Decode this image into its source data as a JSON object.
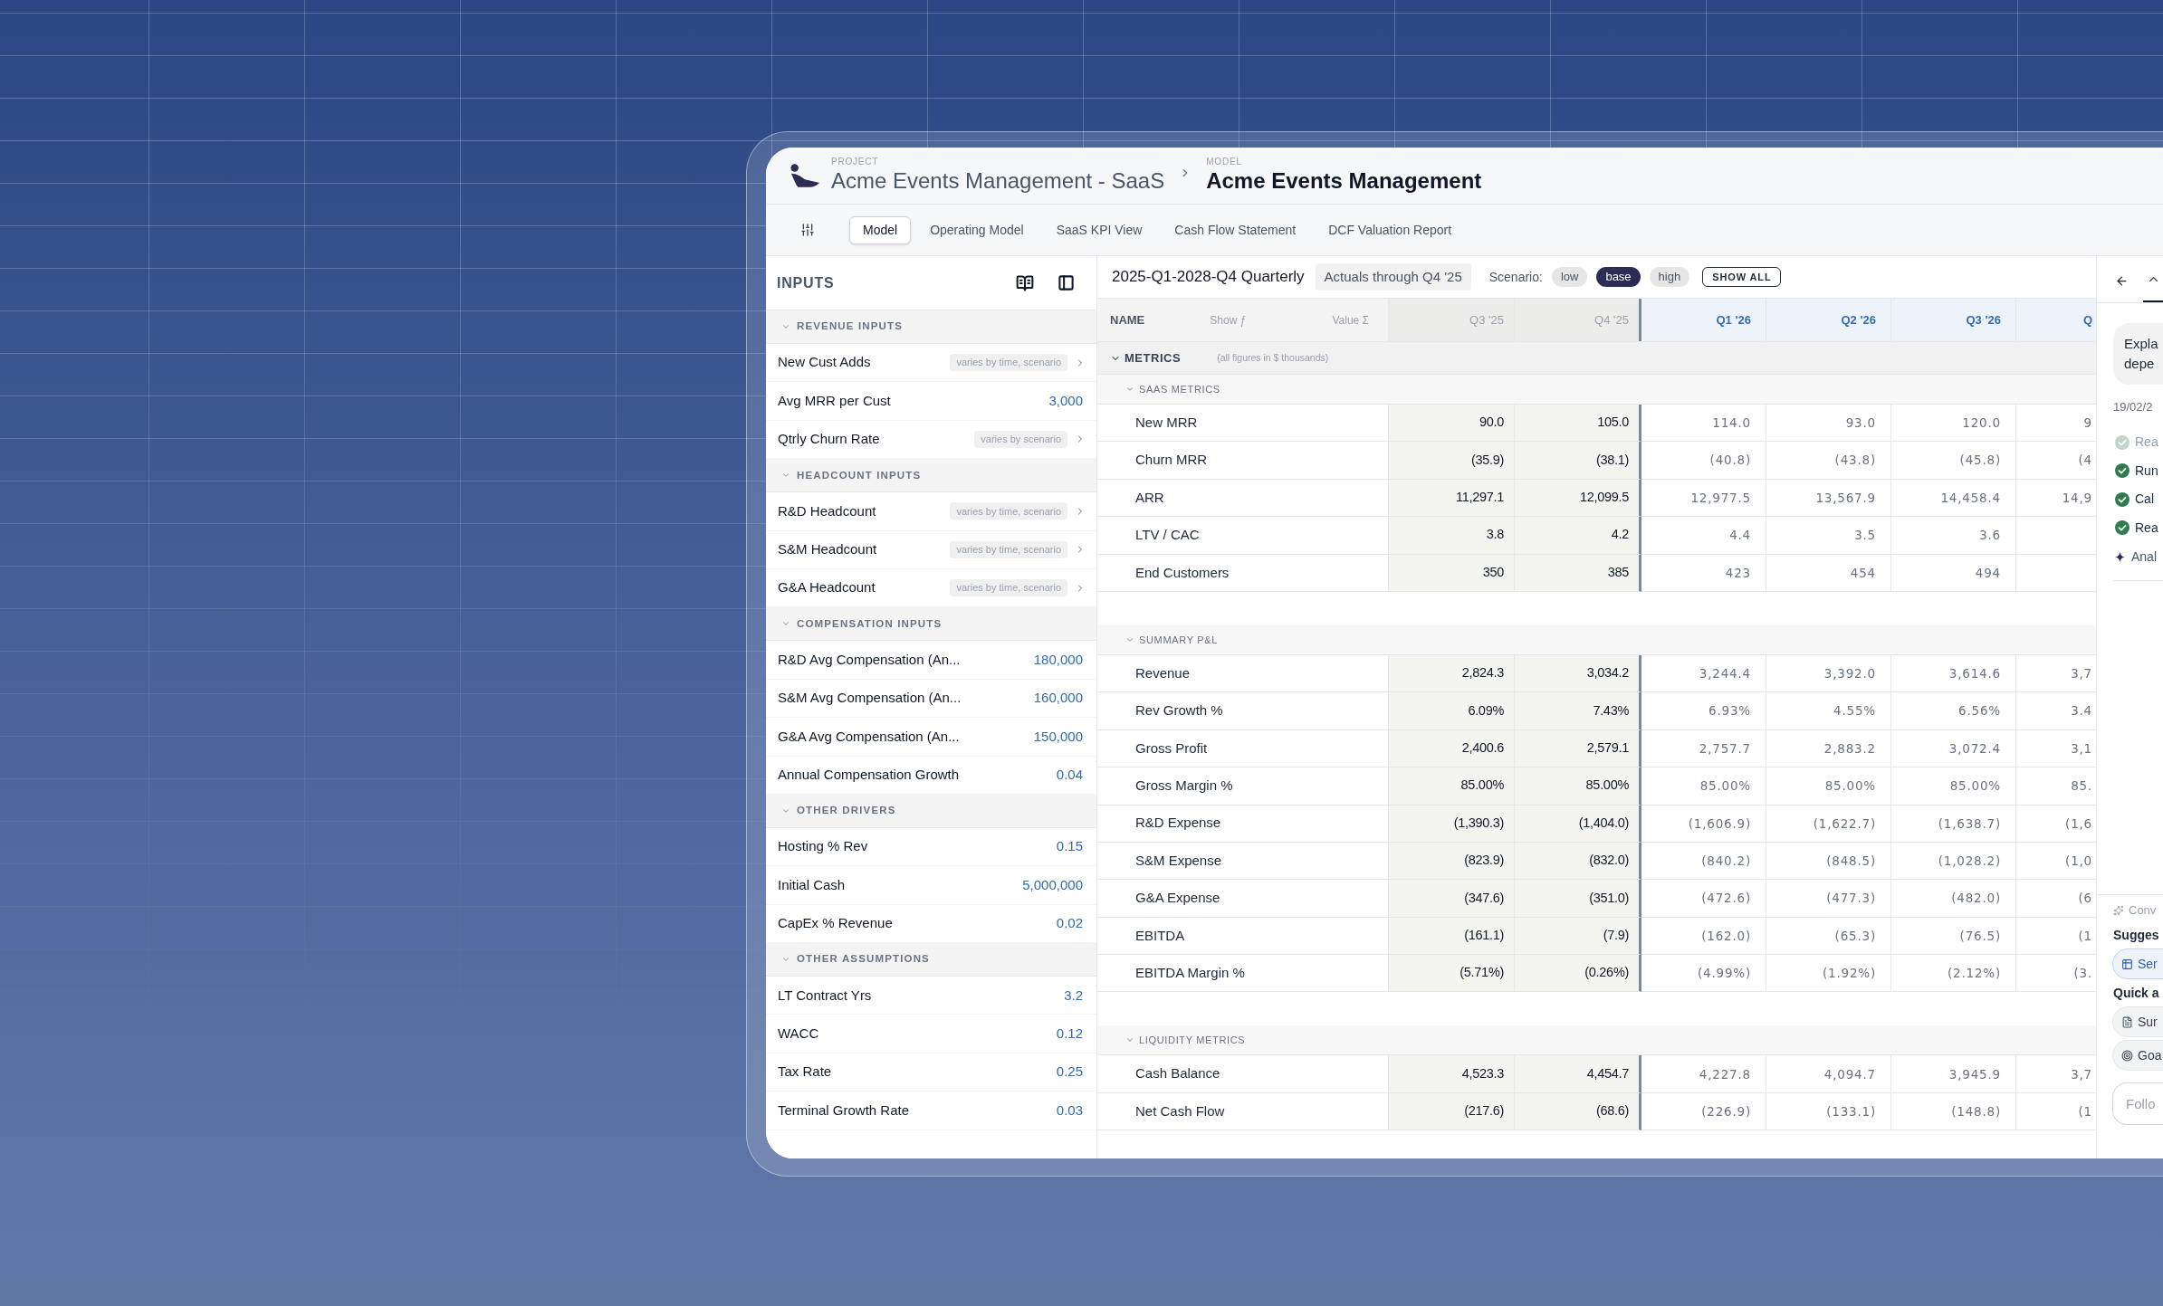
{
  "header": {
    "project_label": "PROJECT",
    "project_name": "Acme Events Management - SaaS",
    "model_label": "MODEL",
    "model_name": "Acme Events Management"
  },
  "tabs": [
    {
      "label": "Model",
      "selected": true
    },
    {
      "label": "Operating Model",
      "selected": false
    },
    {
      "label": "SaaS KPI View",
      "selected": false
    },
    {
      "label": "Cash Flow Statement",
      "selected": false
    },
    {
      "label": "DCF Valuation Report",
      "selected": false
    }
  ],
  "inputs": {
    "title": "INPUTS",
    "sections": [
      {
        "title": "REVENUE INPUTS",
        "expanded": true,
        "items": [
          {
            "label": "New Cust Adds",
            "kind": "varies",
            "badge": "varies by time, scenario"
          },
          {
            "label": "Avg MRR per Cust",
            "kind": "value",
            "value": "3,000"
          },
          {
            "label": "Qtrly Churn Rate",
            "kind": "varies",
            "badge": "varies by scenario"
          }
        ]
      },
      {
        "title": "HEADCOUNT INPUTS",
        "expanded": true,
        "items": [
          {
            "label": "R&D Headcount",
            "kind": "varies",
            "badge": "varies by time, scenario"
          },
          {
            "label": "S&M Headcount",
            "kind": "varies",
            "badge": "varies by time, scenario"
          },
          {
            "label": "G&A Headcount",
            "kind": "varies",
            "badge": "varies by time, scenario"
          }
        ]
      },
      {
        "title": "COMPENSATION INPUTS",
        "expanded": true,
        "items": [
          {
            "label": "R&D Avg Compensation (An...",
            "kind": "value",
            "value": "180,000"
          },
          {
            "label": "S&M Avg Compensation (An...",
            "kind": "value",
            "value": "160,000"
          },
          {
            "label": "G&A Avg Compensation (An...",
            "kind": "value",
            "value": "150,000"
          },
          {
            "label": "Annual Compensation Growth",
            "kind": "value",
            "value": "0.04"
          }
        ]
      },
      {
        "title": "OTHER DRIVERS",
        "expanded": true,
        "items": [
          {
            "label": "Hosting % Rev",
            "kind": "value",
            "value": "0.15"
          },
          {
            "label": "Initial Cash",
            "kind": "value",
            "value": "5,000,000"
          },
          {
            "label": "CapEx % Revenue",
            "kind": "value",
            "value": "0.02"
          }
        ]
      },
      {
        "title": "OTHER ASSUMPTIONS",
        "expanded": true,
        "items": [
          {
            "label": "LT Contract Yrs",
            "kind": "value",
            "value": "3.2"
          },
          {
            "label": "WACC",
            "kind": "value",
            "value": "0.12"
          },
          {
            "label": "Tax Rate",
            "kind": "value",
            "value": "0.25"
          },
          {
            "label": "Terminal Growth Rate",
            "kind": "value",
            "value": "0.03"
          }
        ]
      }
    ]
  },
  "toolbar": {
    "period": "2025-Q1-2028-Q4 Quarterly",
    "actuals": "Actuals through Q4 '25",
    "scenario_label": "Scenario:",
    "scenarios": [
      {
        "label": "low",
        "selected": false
      },
      {
        "label": "base",
        "selected": true
      },
      {
        "label": "high",
        "selected": false
      }
    ],
    "show_all": "SHOW ALL"
  },
  "table": {
    "name_header": "NAME",
    "show_toggle": "Show ƒ",
    "value_toggle": "Value Σ",
    "columns": [
      {
        "label": "Q3 '25",
        "kind": "actual"
      },
      {
        "label": "Q4 '25",
        "kind": "actual"
      },
      {
        "label": "Q1 '26",
        "kind": "forecast"
      },
      {
        "label": "Q2 '26",
        "kind": "forecast"
      },
      {
        "label": "Q3 '26",
        "kind": "forecast"
      },
      {
        "label": "Q",
        "kind": "forecast"
      }
    ],
    "groups": [
      {
        "title": "METRICS",
        "note": "(all figures in $ thousands)",
        "expanded": true,
        "sections": [
          {
            "title": "SAAS METRICS",
            "expanded": true,
            "rows": [
              {
                "label": "New MRR",
                "values": [
                  "90.0",
                  "105.0",
                  "114.0",
                  "93.0",
                  "120.0",
                  "9"
                ]
              },
              {
                "label": "Churn MRR",
                "values": [
                  "(35.9)",
                  "(38.1)",
                  "(40.8)",
                  "(43.8)",
                  "(45.8)",
                  "(4"
                ]
              },
              {
                "label": "ARR",
                "values": [
                  "11,297.1",
                  "12,099.5",
                  "12,977.5",
                  "13,567.9",
                  "14,458.4",
                  "14,9"
                ]
              },
              {
                "label": "LTV / CAC",
                "values": [
                  "3.8",
                  "4.2",
                  "4.4",
                  "3.5",
                  "3.6"
                ]
              },
              {
                "label": "End Customers",
                "values": [
                  "350",
                  "385",
                  "423",
                  "454",
                  "494"
                ]
              }
            ]
          },
          {
            "title": "SUMMARY P&L",
            "expanded": true,
            "rows": [
              {
                "label": "Revenue",
                "values": [
                  "2,824.3",
                  "3,034.2",
                  "3,244.4",
                  "3,392.0",
                  "3,614.6",
                  "3,7"
                ]
              },
              {
                "label": "Rev Growth %",
                "values": [
                  "6.09%",
                  "7.43%",
                  "6.93%",
                  "4.55%",
                  "6.56%",
                  "3.4"
                ]
              },
              {
                "label": "Gross Profit",
                "values": [
                  "2,400.6",
                  "2,579.1",
                  "2,757.7",
                  "2,883.2",
                  "3,072.4",
                  "3,1"
                ]
              },
              {
                "label": "Gross Margin %",
                "values": [
                  "85.00%",
                  "85.00%",
                  "85.00%",
                  "85.00%",
                  "85.00%",
                  "85."
                ]
              },
              {
                "label": "R&D Expense",
                "values": [
                  "(1,390.3)",
                  "(1,404.0)",
                  "(1,606.9)",
                  "(1,622.7)",
                  "(1,638.7)",
                  "(1,6"
                ]
              },
              {
                "label": "S&M Expense",
                "values": [
                  "(823.9)",
                  "(832.0)",
                  "(840.2)",
                  "(848.5)",
                  "(1,028.2)",
                  "(1,0"
                ]
              },
              {
                "label": "G&A Expense",
                "values": [
                  "(347.6)",
                  "(351.0)",
                  "(472.6)",
                  "(477.3)",
                  "(482.0)",
                  "(6"
                ]
              },
              {
                "label": "EBITDA",
                "values": [
                  "(161.1)",
                  "(7.9)",
                  "(162.0)",
                  "(65.3)",
                  "(76.5)",
                  "(1"
                ]
              },
              {
                "label": "EBITDA Margin %",
                "values": [
                  "(5.71%)",
                  "(0.26%)",
                  "(4.99%)",
                  "(1.92%)",
                  "(2.12%)",
                  "(3."
                ]
              }
            ]
          },
          {
            "title": "LIQUIDITY METRICS",
            "expanded": true,
            "rows": [
              {
                "label": "Cash Balance",
                "values": [
                  "4,523.3",
                  "4,454.7",
                  "4,227.8",
                  "4,094.7",
                  "3,945.9",
                  "3,7"
                ]
              },
              {
                "label": "Net Cash Flow",
                "values": [
                  "(217.6)",
                  "(68.6)",
                  "(226.9)",
                  "(133.1)",
                  "(148.8)",
                  "(1"
                ]
              }
            ]
          }
        ]
      }
    ]
  },
  "assistant": {
    "tabs": [
      {
        "selected": true
      }
    ],
    "message": [
      "Expla",
      "depe"
    ],
    "date": "19/02/2",
    "steps": [
      {
        "label": "Rea",
        "faded": true
      },
      {
        "label": "Run",
        "faded": false
      },
      {
        "label": "Cal",
        "faded": false
      },
      {
        "label": "Rea",
        "faded": false
      }
    ],
    "analysis": "Anal",
    "conversation": "Conv",
    "suggestions_title": "Sugges",
    "suggestions": [
      {
        "label": "Ser",
        "kind": "table"
      }
    ],
    "quick_title": "Quick a",
    "quick_actions": [
      {
        "label": "Sur",
        "kind": "document"
      },
      {
        "label": "Goa",
        "kind": "target"
      }
    ],
    "input": {
      "placeholder": "Follo"
    }
  }
}
